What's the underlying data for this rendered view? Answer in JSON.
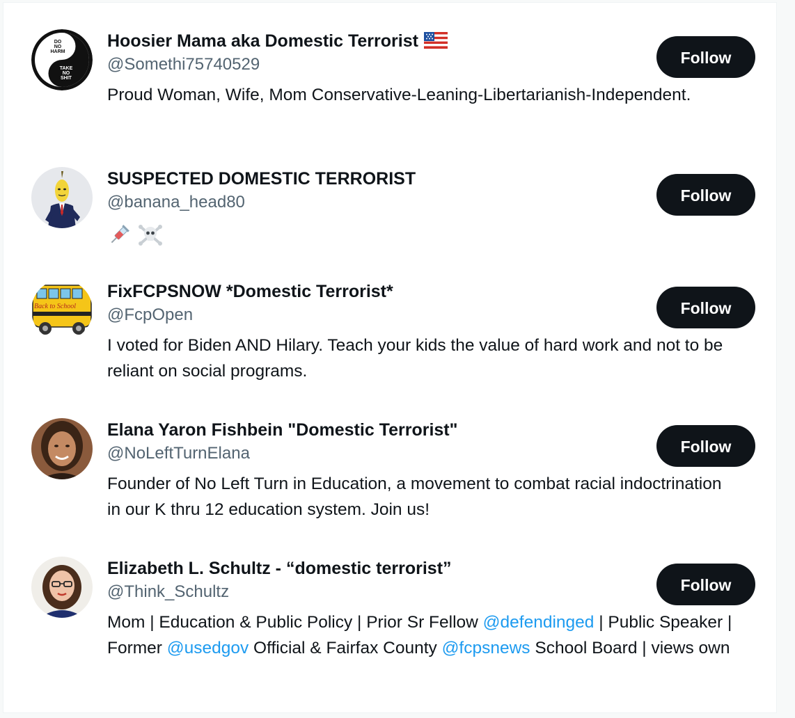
{
  "follow_label": "Follow",
  "users": [
    {
      "name": "Hoosier Mama aka Domestic Terrorist",
      "handle": "@Somethi75740529",
      "bio": "Proud Woman, Wife, Mom Conservative-Leaning-Libertarianish-Independent.",
      "avatar_text_top": "DO NO HARM",
      "avatar_text_bottom": "TAKE NO SHIT",
      "name_icon": "us-flag-emoji"
    },
    {
      "name": "SUSPECTED DOMESTIC TERRORIST",
      "handle": "@banana_head80",
      "bio_icons": [
        "syringe-emoji",
        "skull-crossbones-emoji"
      ]
    },
    {
      "name": "FixFCPSNOW *Domestic Terrorist*",
      "handle": "@FcpOpen",
      "bio": "I voted for Biden AND Hilary. Teach your kids the value of hard work and not to be reliant on social programs.",
      "avatar_text": "Back to School"
    },
    {
      "name": "Elana Yaron Fishbein \"Domestic Terrorist\"",
      "handle": "@NoLeftTurnElana",
      "bio": "Founder of No Left Turn in Education, a movement to combat racial indoctrination in our K thru 12 education system. Join us!"
    },
    {
      "name": "Elizabeth L. Schultz - “domestic terrorist”",
      "handle": "@Think_Schultz",
      "bio_parts": {
        "t1": "Mom | Education & Public Policy | Prior Sr Fellow ",
        "m1": "@defendinged",
        "t2": " | Public Speaker | Former ",
        "m2": "@usedgov",
        "t3": " Official & Fairfax County ",
        "m3": "@fcpsnews",
        "t4": " School Board | views own"
      }
    }
  ],
  "colors": {
    "text": "#0f1419",
    "handle": "#536471",
    "mention": "#1d9bf0",
    "button_bg": "#0f1419",
    "button_text": "#ffffff"
  }
}
